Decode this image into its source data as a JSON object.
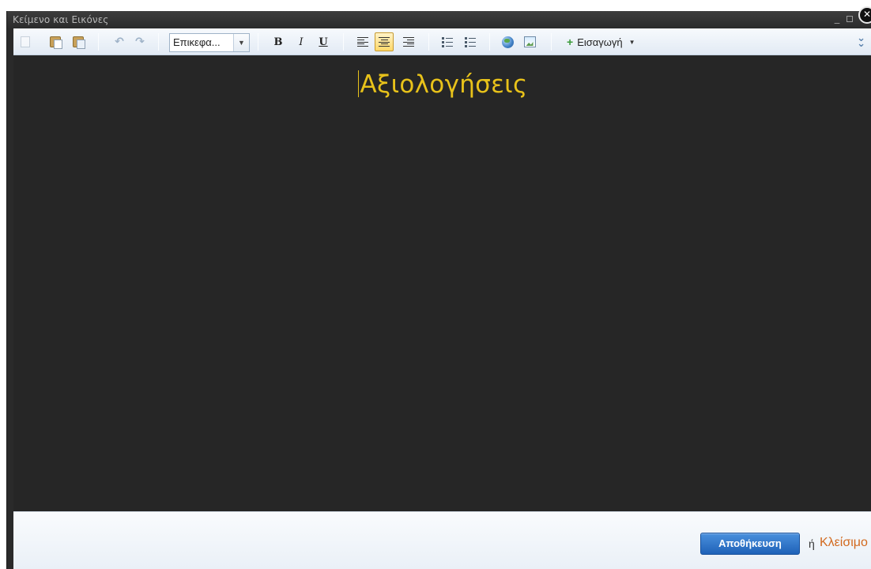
{
  "dialog": {
    "title": "Κείμενο και Εικόνες",
    "minimize_glyph": "_",
    "close_glyph": "✕"
  },
  "toolbar": {
    "format_select": {
      "selected": "Επικεφα..."
    },
    "bold_label": "B",
    "italic_label": "I",
    "underline_label": "U",
    "insert_label": "Εισαγωγή",
    "insert_plus": "+",
    "more_glyph": "»",
    "icons": [
      "copy-icon",
      "paste-icon",
      "paste-text-icon",
      "undo-icon",
      "redo-icon",
      "align-left-icon",
      "align-center-icon",
      "align-right-icon",
      "ordered-list-icon",
      "unordered-list-icon",
      "link-icon",
      "image-icon",
      "more-icon"
    ],
    "active_alignment": "center",
    "active_color": "#ffd869"
  },
  "editor": {
    "heading": "Αξιολογήσεις",
    "heading_color": "#e8c21a",
    "background": "#262626"
  },
  "footer": {
    "save_label": "Αποθήκευση",
    "or_text": "ή",
    "close_label": "Κλείσιμο",
    "save_color": "#1f62b8",
    "close_color": "#d2691e"
  }
}
